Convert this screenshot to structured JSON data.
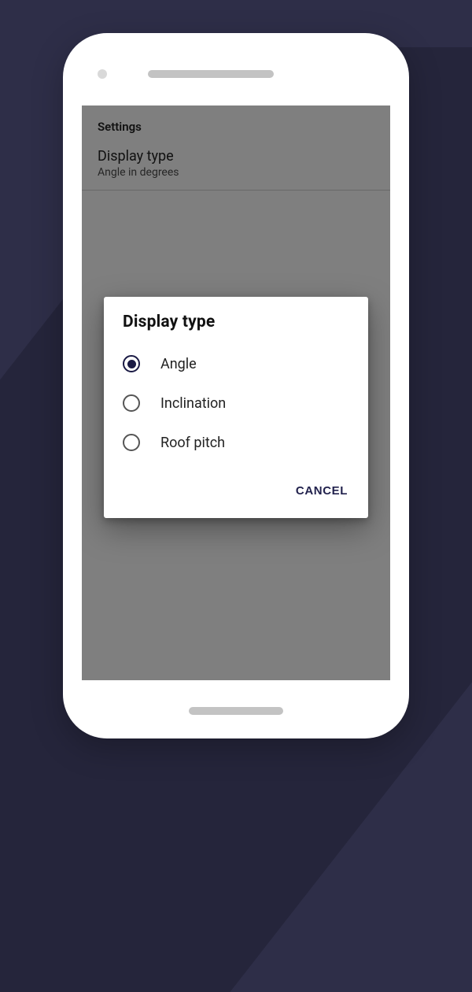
{
  "settings": {
    "header": "Settings",
    "display_type": {
      "title": "Display type",
      "subtitle": "Angle in degrees"
    }
  },
  "dialog": {
    "title": "Display type",
    "options": [
      {
        "label": "Angle",
        "checked": true
      },
      {
        "label": "Inclination",
        "checked": false
      },
      {
        "label": "Roof pitch",
        "checked": false
      }
    ],
    "cancel_label": "CANCEL"
  }
}
